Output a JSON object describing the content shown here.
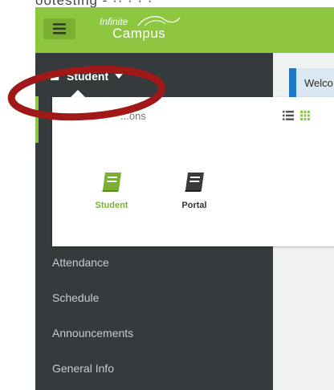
{
  "caption_fragment": "ootesting - ·· · · ·",
  "header": {
    "logo_line1": "Infinite",
    "logo_line2": "Campus",
    "menu_icon": "hamburger-icon",
    "bg_color": "#8dc63f"
  },
  "sidebar": {
    "toggle_label": "Student",
    "toggle_icon": "book-icon",
    "items": [
      {
        "label": "Attendance"
      },
      {
        "label": "Schedule"
      },
      {
        "label": "Announcements"
      },
      {
        "label": "General Info"
      }
    ],
    "bg_color": "#353a3c"
  },
  "dropdown": {
    "partial_label": "...ons",
    "view_list_icon": "list-view-icon",
    "view_grid_icon": "grid-view-icon",
    "apps": [
      {
        "label": "Student",
        "icon": "book-icon",
        "color": "#7ab032"
      },
      {
        "label": "Portal",
        "icon": "book-icon",
        "color": "#333333"
      }
    ]
  },
  "main": {
    "welcome_text": "Welco"
  },
  "annotation": {
    "ring_color": "#b31b1b"
  }
}
